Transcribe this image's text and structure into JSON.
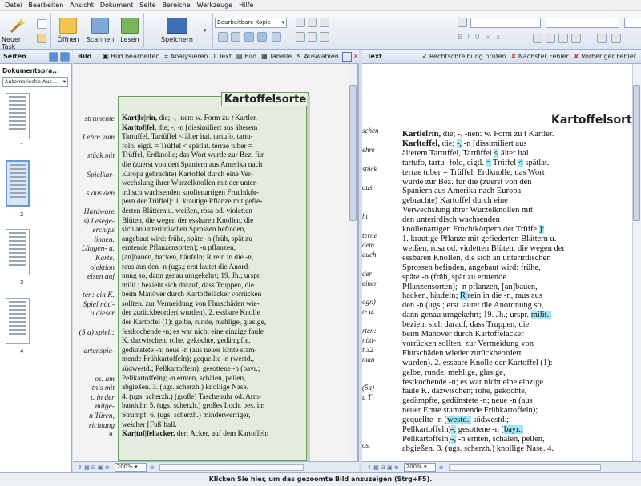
{
  "menu": [
    "Datei",
    "Bearbeiten",
    "Ansicht",
    "Dokument",
    "Seite",
    "Bereiche",
    "Werkzeuge",
    "Hilfe"
  ],
  "toolbar": {
    "new_task": "Neuer Task",
    "open": "Öffnen",
    "scan": "Scannen",
    "read": "Lesen",
    "save": "Speichern",
    "copy_mode": "Bearbeitbare Kopie"
  },
  "pages_panel": {
    "title": "Seiten",
    "doc_lang_label": "Dokumentspra...",
    "doc_lang_value": "Automatische Aus...",
    "pages": [
      "1",
      "2",
      "3",
      "4"
    ]
  },
  "image_panel": {
    "title": "Bild",
    "tools": [
      "Bild bearbeiten",
      "Analysieren",
      "Text",
      "Bild",
      "Tabelle",
      "Auswählen"
    ],
    "heading": "Kartoffelsorte",
    "zoom": "200%",
    "left_column": [
      "strumente",
      "",
      "Lehre vom",
      "",
      "stück mit",
      "",
      "Spielkar-",
      "",
      "s aus den",
      "",
      "Hardware",
      "s) Lesege-",
      "erchips",
      "önnen.",
      "Längen- u.",
      "Karte.",
      "ojektion",
      "eisen auf",
      "",
      "ten: ein K.",
      "Spiel nöti-",
      "u dieser",
      "",
      "(5 a) spielt:",
      "",
      "artenspie-",
      "",
      "",
      "os. am",
      "tnis mit",
      "t. in der",
      "mitge-",
      "n Türen,",
      "richtung",
      "n."
    ],
    "main_text": [
      "Kart|le|rin, die; -, -nen: w. Form zu ↑Kartler.",
      "Kar|tof|fel, die; -, -n [dissimiliert aus älterem",
      "Tartuffel, Tartüffel < älter ital. tartufo, tartu-",
      "folo, eigtl. = Trüffel < spätlat. terrae tuber =",
      "Trüffel, Erdknolle; das Wort wurde zur Bez. für",
      "die (zuerst von den Spaniern aus Amerika nach",
      "Europa gebrachte) Kartoffel durch eine Ver-",
      "wechslung ihrer Wurzelknollen mit der unter-",
      "irdisch wachsenden knollenartigen Fruchtkör-",
      "pern der Trüffel]: 1. krautige Pflanze mit gefie-",
      "derten Blättern u. weißen, rosa od. violetten",
      "Blüten, die wegen der essbaren Knollen, die",
      "sich an unterirdischen Sprossen befinden,",
      "angebaut wird: frühe, späte -n (früh, spät zu",
      "erntende Pflanzensorten); -n pflanzen,",
      "[an]bauen, hacken, häufeln; R rein in die -n,",
      "raus aus den -n (ugs.; erst lautet die Anord-",
      "nung so, dann genau umgekehrt; 19. Jh.; urspr.",
      "milit.; bezieht sich darauf, dass Truppen, die",
      "beim Manöver durch Kartoffeläcker vorrücken",
      "sollten, zur Vermeidung von Flurschäden wie-",
      "der zurückbeordert wurden). 2. essbare Knolle",
      "der Kartoffel (1): gelbe, runde, mehlige, glasige,",
      "festkochende -n; es war nicht eine einzige faule",
      "K. dazwischen; rohe, gekochte, gedämpfte,",
      "gedünstete -n; neue -n (aus neuer Ernte stam-",
      "mende Frühkartoffeln); gequellte -n (westd.,",
      "südwestd.; Pellkartoffeln); gesottene -n (bayr.;",
      "Pellkartoffeln); -n ernten, schälen, pellen,",
      "abgießen. 3. (ugs. scherzh.) knollige Nase.",
      "4. (ugs. scherzh.) (große) Taschenuhr od. Arm-",
      "banduhr. 5. (ugs. scherzh.) großes Loch, bes. im",
      "Strumpf. 6. (ugs. scherzh.) minderwertiger,",
      "weicher [Fuß]ball.",
      "Kar|tof|fel|acker, der: Acker, auf dem Kartoffeln"
    ]
  },
  "text_panel": {
    "title": "Text",
    "spellcheck": "Rechtschreibung prüfen",
    "next_error": "Nächster Fehler",
    "prev_error": "Vorheriger Fehler",
    "heading": "Kartoffelsorte",
    "zoom": "200%",
    "left_column": [
      "schen",
      "",
      "ehre",
      "",
      "stück",
      "",
      "aus",
      "",
      "",
      "ht",
      "",
      "terne",
      "dem",
      "auch",
      "",
      "der",
      "einer",
      "",
      "ogr.)",
      "r- u.",
      "",
      "rten:",
      "nöti-",
      "t 32",
      "man",
      "",
      "",
      "(5a)",
      "u T",
      "",
      "",
      "",
      "",
      "os."
    ],
    "lines": [
      "Kartlelrin, die; -, -nen: w. Form zu t Kartler.",
      "Karltoffel, die; -, -n [dissimiliert aus",
      "älterem Tartuffel, Tartüffel < älter ital.",
      "tartufo, tartu- folo, eigtl. = Trüffel < spätlat.",
      "terrae tuber = Trüffel, Erdknolle; das Wort",
      "wurde zur Bez. für die (zuerst von den",
      "Spaniern aus Amerika nach Europa",
      "gebrachte) Kartoffel durch eine",
      "Verwechslung ihrer Wurzelknollen mit",
      "den unterirdisch wachsenden",
      "knollenartigen Fruchtkörpern der Trüffel]:",
      "1. krautige Pflanze mit gefiederten Blättern u.",
      "weißen, rosa od. violetten Blüten, die wegen der",
      "essbaren Knollen, die sich an unterirdischen",
      "Sprossen befinden, angebaut wird: frühe,",
      "späte -n (früh, spät zu erntende",
      "Pflanzensorten); -n pflanzen, [an]bauen,",
      "hacken, häufeln; R rein in die -n, raus aus",
      "den -n (ugs.; erst lautet die Anordnung so,",
      "dann genau umgekehrt; 19. Jh.; urspr. milit.;",
      "bezieht sich darauf, dass Truppen, die",
      "beim Manöver durch Kartoffeläcker",
      "vorrücken sollten, zur Vermeidung von",
      "Flurschäden wieder zurückbeordert",
      "wurden). 2. essbare Knolle der Kartoffel (1):",
      "gelbe, runde, mehlige, glasige,",
      "festkochende -n; es war nicht eine einzige",
      "faule K. dazwischen; rohe, gekochte,",
      "gedämpfte, gedünstete -n; neue -n (aus",
      "neuer Ernte stammende Frühkartoffeln);",
      "gequellte -n (westd., südwestd.;",
      "Pellkartoffeln)-, gesottene -n (bayr.;",
      "Pellkartoffeln)-, -n ernten, schälen, pellen,",
      "abgießen. 3. (ugs. scherzh.) knollige Nase. 4."
    ]
  },
  "status_hint": "Klicken Sie hier, um das gezoomte Bild anzuzeigen (Strg+F5)."
}
